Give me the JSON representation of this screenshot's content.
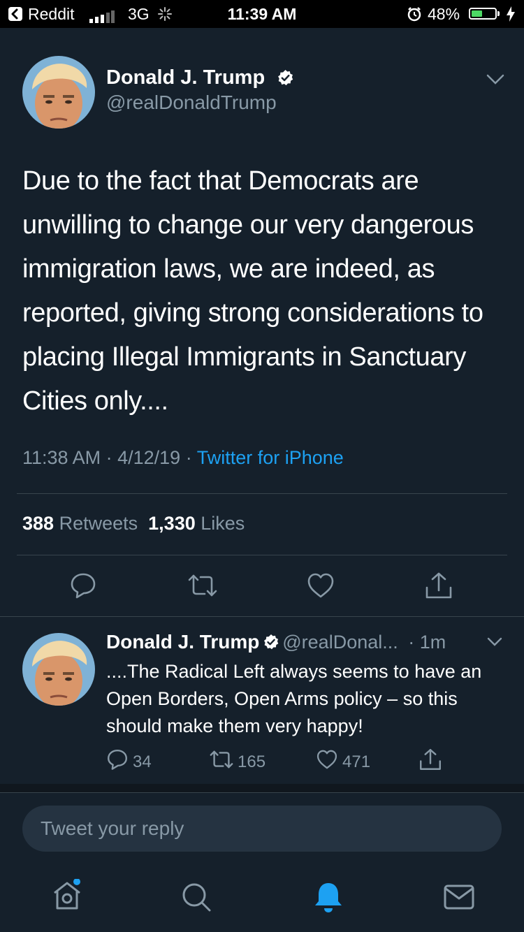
{
  "status_bar": {
    "back_app": "Reddit",
    "network": "3G",
    "time": "11:39 AM",
    "battery": "48%",
    "battery_level": 0.48,
    "colors": {
      "battery_fill": "#4cd964"
    }
  },
  "tweet": {
    "author_name": "Donald J. Trump",
    "author_handle": "@realDonaldTrump",
    "text": "Due to the fact that Democrats are unwilling to change our very dangerous immigration laws, we are indeed, as reported, giving strong considerations to placing Illegal Immigrants in Sanctuary Cities only....",
    "time": "11:38 AM",
    "date": "4/12/19",
    "separator": "·",
    "source": "Twitter for iPhone",
    "retweets_count": "388",
    "retweets_label": "Retweets",
    "likes_count": "1,330",
    "likes_label": "Likes"
  },
  "reply": {
    "author_name": "Donald J. Trump",
    "author_handle": "@realDonal...",
    "age": "· 1m",
    "text": "....The Radical Left always seems to have an Open Borders, Open Arms policy – so this should make them very happy!",
    "replies": "34",
    "retweets": "165",
    "likes": "471"
  },
  "composer": {
    "placeholder": "Tweet your reply"
  },
  "tabs": [
    "home-icon",
    "search-icon",
    "notifications-icon",
    "messages-icon"
  ],
  "colors": {
    "background": "#15202b",
    "secondary_text": "#8899a6",
    "accent": "#1da1f2",
    "divider": "#38444d"
  }
}
